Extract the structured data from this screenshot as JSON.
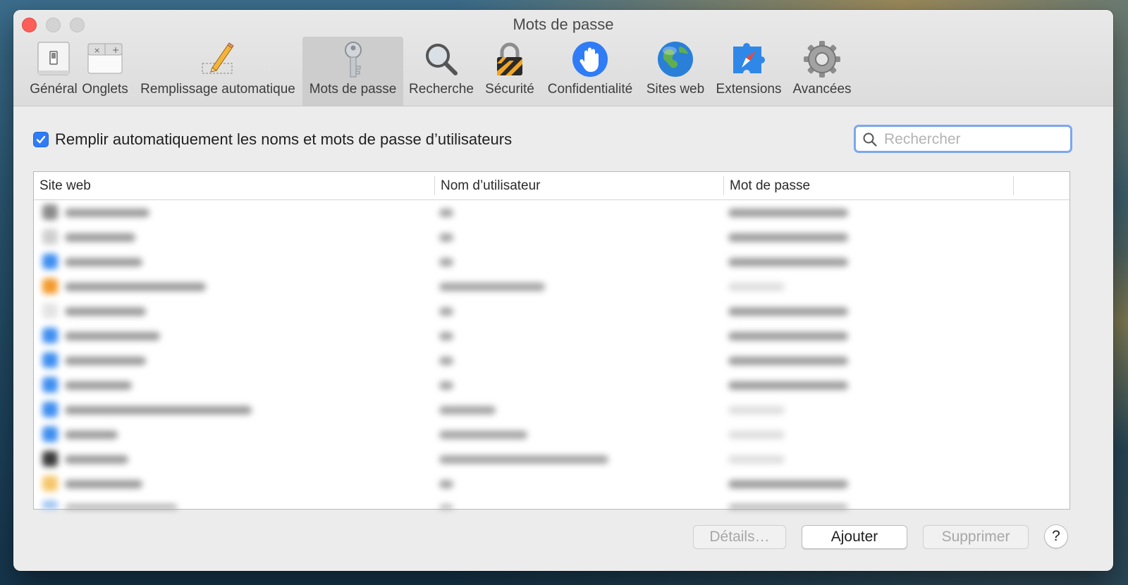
{
  "window": {
    "title": "Mots de passe"
  },
  "toolbar": {
    "items": [
      {
        "label": "Général",
        "icon": "general-switch-icon"
      },
      {
        "label": "Onglets",
        "icon": "tabs-icon"
      },
      {
        "label": "Remplissage automatique",
        "icon": "pencil-autofill-icon"
      },
      {
        "label": "Mots de passe",
        "icon": "key-icon",
        "selected": true
      },
      {
        "label": "Recherche",
        "icon": "magnifier-icon"
      },
      {
        "label": "Sécurité",
        "icon": "padlock-icon"
      },
      {
        "label": "Confidentialité",
        "icon": "privacy-hand-icon"
      },
      {
        "label": "Sites web",
        "icon": "globe-icon"
      },
      {
        "label": "Extensions",
        "icon": "compass-puzzle-icon"
      },
      {
        "label": "Avancées",
        "icon": "gear-icon"
      }
    ]
  },
  "autofill": {
    "label": "Remplir automatiquement les noms et mots de passe d’utilisateurs",
    "checked": true
  },
  "search": {
    "placeholder": "Rechercher",
    "value": ""
  },
  "table": {
    "columns": [
      "Site web",
      "Nom d’utilisateur",
      "Mot de passe"
    ]
  },
  "buttons": {
    "details": "Détails…",
    "add": "Ajouter",
    "remove": "Supprimer",
    "help": "?"
  },
  "colors": {
    "accent": "#2f7cf6",
    "close": "#fc5f57",
    "selected_tab": "#cdcdcd"
  }
}
